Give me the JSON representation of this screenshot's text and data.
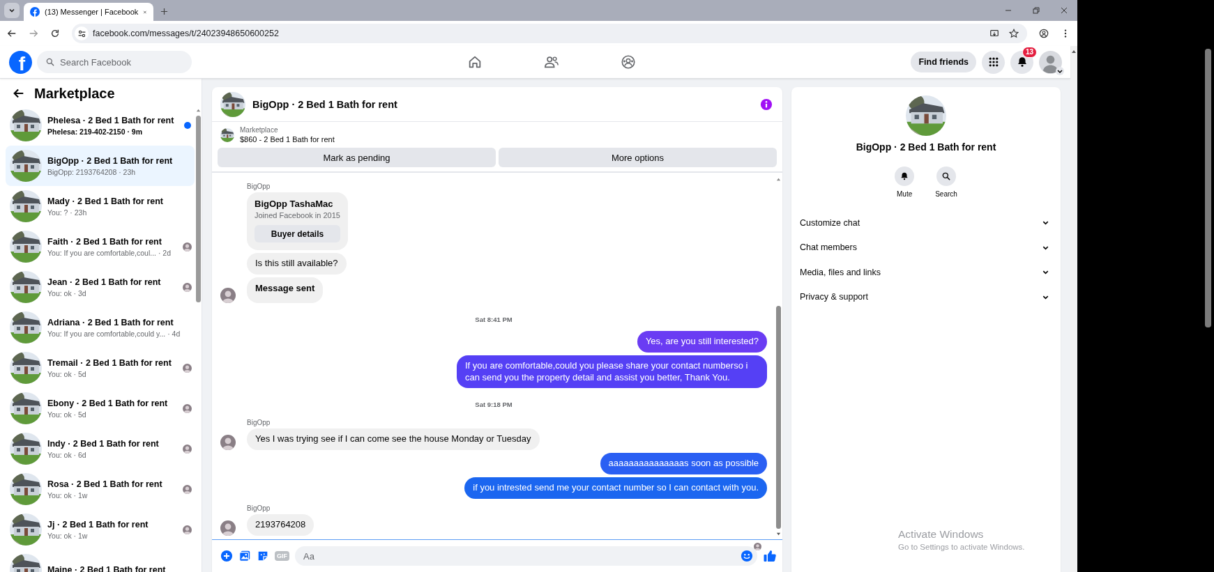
{
  "browser": {
    "tab_title": "(13) Messenger | Facebook",
    "url": "facebook.com/messages/t/24023948650600252"
  },
  "top_nav": {
    "logo": "f",
    "search_placeholder": "Search Facebook",
    "nav_items": [
      {
        "selected": false
      },
      {
        "selected": false
      },
      {
        "selected": false
      }
    ],
    "find_friends": "Find friends",
    "notification_count": "13"
  },
  "sidebar": {
    "title": "Marketplace",
    "conversations": [
      {
        "name": "Phelesa · 2 Bed 1 Bath for rent",
        "subtitle": "Phelesa: 219-402-2150 · 9m",
        "unread": true,
        "selected": false,
        "seen": false
      },
      {
        "name": "BigOpp · 2 Bed 1 Bath for rent",
        "subtitle": "BigOpp: 2193764208 · 23h",
        "unread": false,
        "selected": true,
        "seen": false
      },
      {
        "name": "Mady · 2 Bed 1 Bath for rent",
        "subtitle": "You: ? · 23h",
        "unread": false,
        "selected": false,
        "seen": false
      },
      {
        "name": "Faith · 2 Bed 1 Bath for rent",
        "subtitle": "You: If you are comfortable,coul...  · 2d",
        "unread": false,
        "selected": false,
        "seen": true
      },
      {
        "name": "Jean · 2 Bed 1 Bath for rent",
        "subtitle": "You: ok · 3d",
        "unread": false,
        "selected": false,
        "seen": true
      },
      {
        "name": "Adriana · 2 Bed 1 Bath for rent",
        "subtitle": "You: If you are comfortable,could y...  · 4d",
        "unread": false,
        "selected": false,
        "seen": false
      },
      {
        "name": "Tremail · 2 Bed 1 Bath for rent",
        "subtitle": "You: ok · 5d",
        "unread": false,
        "selected": false,
        "seen": true
      },
      {
        "name": "Ebony · 2 Bed 1 Bath for rent",
        "subtitle": "You: ok · 5d",
        "unread": false,
        "selected": false,
        "seen": true
      },
      {
        "name": "Indy · 2 Bed 1 Bath for rent",
        "subtitle": "You: ok · 6d",
        "unread": false,
        "selected": false,
        "seen": true
      },
      {
        "name": "Rosa · 2 Bed 1 Bath for rent",
        "subtitle": "You: ok · 1w",
        "unread": false,
        "selected": false,
        "seen": true
      },
      {
        "name": "Jj · 2 Bed 1 Bath for rent",
        "subtitle": "You: ok · 1w",
        "unread": false,
        "selected": false,
        "seen": true
      },
      {
        "name": "Maine · 2 Bed 1 Bath for rent",
        "unread": false,
        "selected": false,
        "seen": false
      }
    ]
  },
  "chat": {
    "title": "BigOpp · 2 Bed 1 Bath for rent",
    "listing": {
      "label": "Marketplace",
      "detail": "$860 - 2 Bed 1 Bath for rent",
      "buttons": [
        "Mark as pending",
        "More options"
      ]
    },
    "messages": [
      {
        "kind": "sender",
        "text": "BigOpp"
      },
      {
        "kind": "profile_card",
        "name": "BigOpp TashaMac",
        "subtitle": "Joined Facebook in 2015",
        "button": "Buyer details"
      },
      {
        "kind": "incoming",
        "text": "Is this still available?",
        "avatar": false,
        "emphasis": false
      },
      {
        "kind": "incoming",
        "text": "Message sent",
        "avatar": true,
        "emphasis": true
      },
      {
        "kind": "time",
        "text": "Sat 8:41 PM"
      },
      {
        "kind": "outgoing",
        "text": "Yes, are you still interested?",
        "color": "#6a3cf3"
      },
      {
        "kind": "outgoing",
        "text": "If you are comfortable,could you please share your contact numberso i can send you the property detail and assist you better, Thank You.",
        "color": "#5540f5"
      },
      {
        "kind": "time",
        "text": "Sat 9:18 PM"
      },
      {
        "kind": "sender",
        "text": "BigOpp"
      },
      {
        "kind": "incoming",
        "text": "Yes I was trying see if I can come see the house Monday or Tuesday",
        "avatar": true,
        "emphasis": false
      },
      {
        "kind": "outgoing",
        "text": "aaaaaaaaaaaaaaas soon as possible",
        "color": "#2a5ff3"
      },
      {
        "kind": "outgoing",
        "text": "if you intrested send me your contact number  so I can contact with you.",
        "color": "#1b66f0"
      },
      {
        "kind": "sender",
        "text": "BigOpp"
      },
      {
        "kind": "incoming",
        "text": "2193764208",
        "avatar": true,
        "emphasis": false
      },
      {
        "kind": "seen"
      }
    ],
    "composer": {
      "gif": "GIF",
      "placeholder": "Aa"
    }
  },
  "details": {
    "title": "BigOpp · 2 Bed 1 Bath for rent",
    "actions": [
      {
        "label": "Mute"
      },
      {
        "label": "Search"
      }
    ],
    "sections": [
      {
        "label": "Customize chat",
        "expanded": false
      },
      {
        "label": "Chat members",
        "expanded": false
      },
      {
        "label": "Media, files and links",
        "expanded": false
      },
      {
        "label": "Privacy & support",
        "expanded": false
      }
    ]
  },
  "os_notice": {
    "title": "Activate Windows",
    "subtitle": "Go to Settings to activate Windows."
  }
}
